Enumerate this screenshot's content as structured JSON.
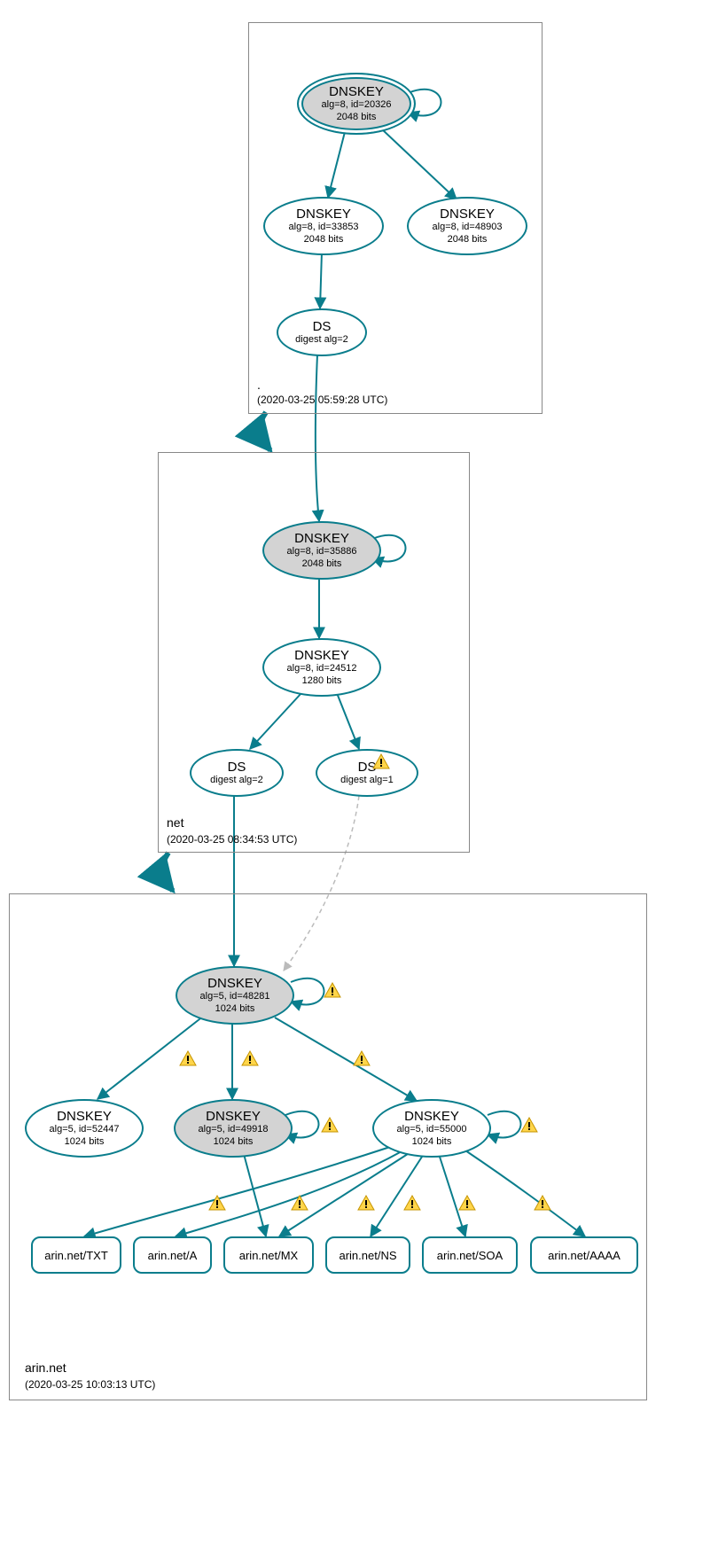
{
  "zones": {
    "root": {
      "label": ".",
      "timestamp": "(2020-03-25 05:59:28 UTC)"
    },
    "net": {
      "label": "net",
      "timestamp": "(2020-03-25 08:34:53 UTC)"
    },
    "arin": {
      "label": "arin.net",
      "timestamp": "(2020-03-25 10:03:13 UTC)"
    }
  },
  "nodes": {
    "root_ksk": {
      "title": "DNSKEY",
      "detail1": "alg=8, id=20326",
      "detail2": "2048 bits"
    },
    "root_zsk1": {
      "title": "DNSKEY",
      "detail1": "alg=8, id=33853",
      "detail2": "2048 bits"
    },
    "root_zsk2": {
      "title": "DNSKEY",
      "detail1": "alg=8, id=48903",
      "detail2": "2048 bits"
    },
    "root_ds": {
      "title": "DS",
      "detail1": "digest alg=2"
    },
    "net_ksk": {
      "title": "DNSKEY",
      "detail1": "alg=8, id=35886",
      "detail2": "2048 bits"
    },
    "net_zsk": {
      "title": "DNSKEY",
      "detail1": "alg=8, id=24512",
      "detail2": "1280 bits"
    },
    "net_ds1": {
      "title": "DS",
      "detail1": "digest alg=2"
    },
    "net_ds2": {
      "title": "DS",
      "detail1": "digest alg=1"
    },
    "arin_ksk": {
      "title": "DNSKEY",
      "detail1": "alg=5, id=48281",
      "detail2": "1024 bits"
    },
    "arin_dk1": {
      "title": "DNSKEY",
      "detail1": "alg=5, id=52447",
      "detail2": "1024 bits"
    },
    "arin_dk2": {
      "title": "DNSKEY",
      "detail1": "alg=5, id=49918",
      "detail2": "1024 bits"
    },
    "arin_dk3": {
      "title": "DNSKEY",
      "detail1": "alg=5, id=55000",
      "detail2": "1024 bits"
    },
    "rr_txt": {
      "label": "arin.net/TXT"
    },
    "rr_a": {
      "label": "arin.net/A"
    },
    "rr_mx": {
      "label": "arin.net/MX"
    },
    "rr_ns": {
      "label": "arin.net/NS"
    },
    "rr_soa": {
      "label": "arin.net/SOA"
    },
    "rr_aaaa": {
      "label": "arin.net/AAAA"
    }
  }
}
